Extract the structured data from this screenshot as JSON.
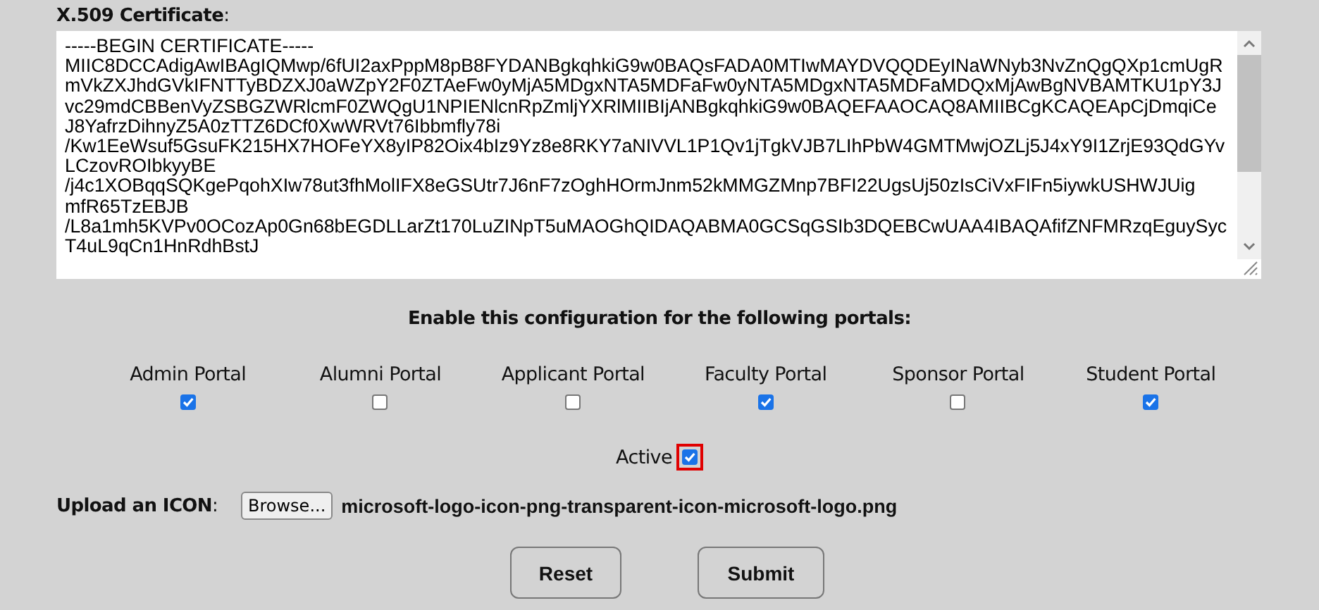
{
  "certificate": {
    "label": "X.509 Certificate",
    "label_suffix": ":",
    "lines": [
      "-----BEGIN CERTIFICATE-----",
      "MIIC8DCCAdigAwIBAgIQMwp/6fUI2axPppM8pB8FYDANBgkqhkiG9w0BAQsFADA0MTIwMAYDVQQDEyINaWNyb3NvZnQgQXp1cmUgR",
      "mVkZXJhdGVkIFNTTyBDZXJ0aWZpY2F0ZTAeFw0yMjA5MDgxNTA5MDFaFw0yNTA5MDgxNTA5MDFaMDQxMjAwBgNVBAMTKU1pY3J",
      "vc29mdCBBenVyZSBGZWRlcmF0ZWQgU1NPIENlcnRpZmljYXRlMIIBIjANBgkqhkiG9w0BAQEFAAOCAQ8AMIIBCgKCAQEApCjDmqiCe",
      "J8YafrzDihnyZ5A0zTTZ6DCf0XwWRVt76Ibbmfly78i",
      "/Kw1EeWsuf5GsuFK215HX7HOFeYX8yIP82Oix4bIz9Yz8e8RKY7aNIVVL1P1Qv1jTgkVJB7LIhPbW4GMTMwjOZLj5J4xY9I1ZrjE93QdGYv",
      "LCzovROIbkyyBE",
      "/j4c1XOBqqSQKgePqohXIw78ut3fhMolIFX8eGSUtr7J6nF7zOghHOrmJnm52kMMGZMnp7BFI22UgsUj50zIsCiVxFIFn5iywkUSHWJUig",
      "mfR65TzEBJB",
      "/L8a1mh5KVPv0OCozAp0Gn68bEGDLLarZt170LuZINpT5uMAOGhQIDAQABMA0GCSqGSIb3DQEBCwUAA4IBAQAfifZNFMRzqEguySyc",
      "T4uL9qCn1HnRdhBstJ"
    ]
  },
  "portals_heading": "Enable this configuration for the following portals:",
  "portals": [
    {
      "label": "Admin Portal",
      "checked": true
    },
    {
      "label": "Alumni Portal",
      "checked": false
    },
    {
      "label": "Applicant Portal",
      "checked": false
    },
    {
      "label": "Faculty Portal",
      "checked": true
    },
    {
      "label": "Sponsor Portal",
      "checked": false
    },
    {
      "label": "Student Portal",
      "checked": true
    }
  ],
  "active": {
    "label": "Active",
    "checked": true,
    "focused": true
  },
  "upload": {
    "label": "Upload an ICON",
    "label_suffix": ":",
    "button": "Browse...",
    "filename": "microsoft-logo-icon-png-transparent-icon-microsoft-logo.png"
  },
  "buttons": [
    "Reset",
    "Submit"
  ]
}
